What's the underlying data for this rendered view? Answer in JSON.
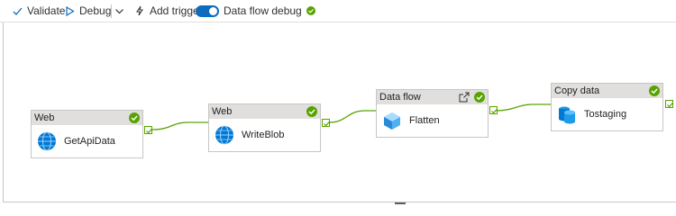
{
  "toolbar": {
    "validate": "Validate",
    "debug": "Debug",
    "add_trigger": "Add trigger",
    "data_flow_debug": "Data flow debug",
    "data_flow_debug_on": true
  },
  "activities": [
    {
      "type": "Web",
      "name": "GetApiData",
      "icon": "globe-icon",
      "status": "succeeded"
    },
    {
      "type": "Web",
      "name": "WriteBlob",
      "icon": "globe-icon",
      "status": "succeeded"
    },
    {
      "type": "Data flow",
      "name": "Flatten",
      "icon": "dataflow-icon",
      "status": "succeeded"
    },
    {
      "type": "Copy data",
      "name": "Tostaging",
      "icon": "database-icon",
      "status": "succeeded"
    }
  ],
  "colors": {
    "accent": "#0f6cbd",
    "success": "#57a300",
    "header": "#e1dfdd",
    "edge": "#57a300"
  }
}
